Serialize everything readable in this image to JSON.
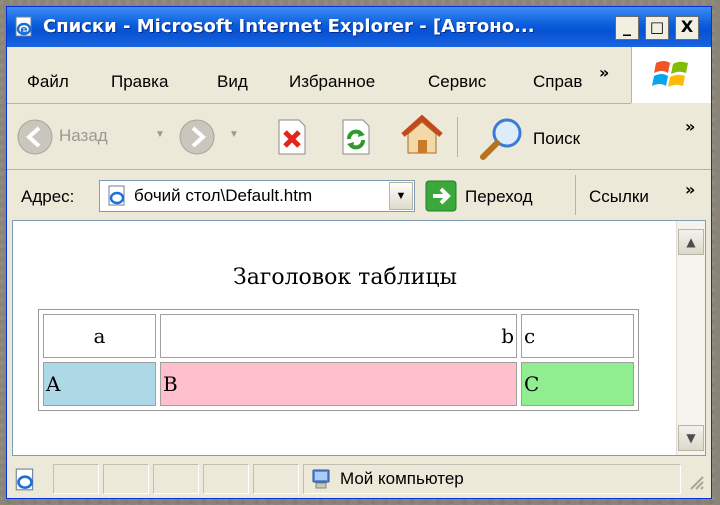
{
  "window": {
    "title": "Списки - Microsoft Internet Explorer - [Автоно...",
    "min_symbol": "_",
    "max_symbol": "□",
    "close_symbol": "X"
  },
  "menu": {
    "items": [
      "Файл",
      "Правка",
      "Вид",
      "Избранное",
      "Сервис",
      "Справ"
    ],
    "overflow": "»"
  },
  "toolbar": {
    "back_label": "Назад",
    "search_label": "Поиск",
    "overflow": "»"
  },
  "address": {
    "label": "Адрес:",
    "value": "бочий стол\\Default.htm",
    "go_label": "Переход",
    "links_label": "Ссылки",
    "overflow": "»"
  },
  "page": {
    "caption": "Заголовок таблицы",
    "rows": [
      [
        "a",
        "b",
        "c"
      ],
      [
        "A",
        "B",
        "C"
      ]
    ],
    "cell_colors": [
      "#add8e6",
      "#ffc0cb",
      "#90ee90"
    ]
  },
  "status": {
    "zone_label": "Мой компьютер"
  }
}
